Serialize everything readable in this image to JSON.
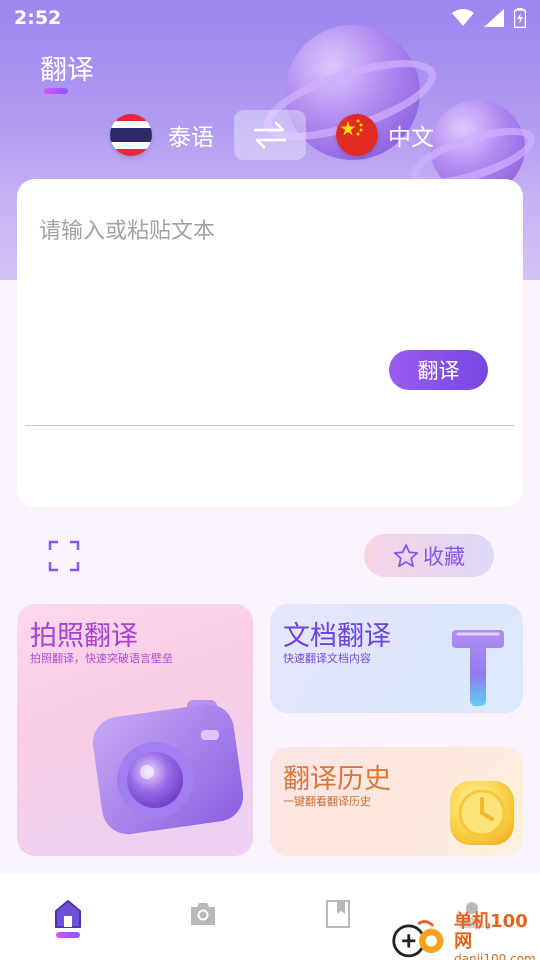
{
  "status_bar": {
    "time": "2:52"
  },
  "header": {
    "title": "翻译"
  },
  "languages": {
    "source": {
      "label": "泰语",
      "flag": "thailand-flag"
    },
    "target": {
      "label": "中文",
      "flag": "china-flag"
    }
  },
  "input": {
    "placeholder": "请输入或粘贴文本",
    "value": ""
  },
  "translate_button": {
    "label": "翻译"
  },
  "favorite_button": {
    "label": "收藏"
  },
  "features": {
    "photo": {
      "title": "拍照翻译",
      "subtitle": "拍照翻译，快速突破语言壁垒"
    },
    "document": {
      "title": "文档翻译",
      "subtitle": "快速翻译文档内容"
    },
    "history": {
      "title": "翻译历史",
      "subtitle": "一键翻看翻译历史"
    }
  },
  "bottom_nav": [
    {
      "name": "home",
      "icon": "home-icon",
      "active": true
    },
    {
      "name": "camera",
      "icon": "camera-icon",
      "active": false
    },
    {
      "name": "bookmark",
      "icon": "bookmark-icon",
      "active": false
    },
    {
      "name": "profile",
      "icon": "person-icon",
      "active": false
    }
  ],
  "watermark": {
    "main": "单机100网",
    "sub": "danji100.com"
  },
  "colors": {
    "accent": "#8a55f0",
    "photo_title": "#a93ed8",
    "doc_title": "#6c45e0",
    "history_title": "#d9783a"
  }
}
